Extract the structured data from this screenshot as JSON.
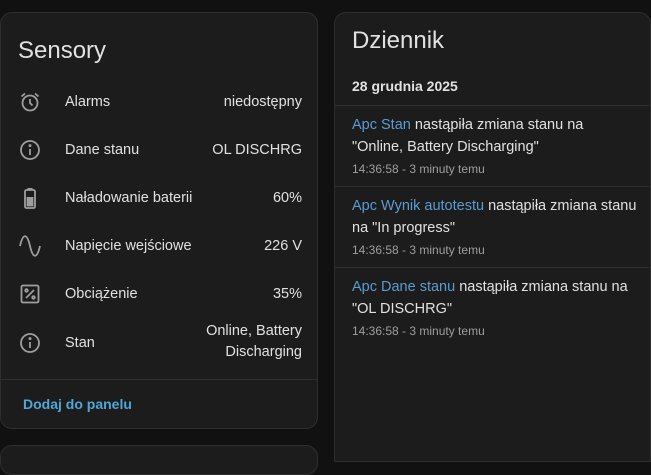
{
  "sensors": {
    "title": "Sensory",
    "rows": [
      {
        "icon": "alarm-clock-icon",
        "label": "Alarms",
        "value": "niedostępny"
      },
      {
        "icon": "info-icon",
        "label": "Dane stanu",
        "value": "OL DISCHRG"
      },
      {
        "icon": "battery-icon",
        "label": "Naładowanie baterii",
        "value": "60%"
      },
      {
        "icon": "sine-wave-icon",
        "label": "Napięcie wejściowe",
        "value": "226 V"
      },
      {
        "icon": "percent-box-icon",
        "label": "Obciążenie",
        "value": "35%"
      },
      {
        "icon": "info-icon",
        "label": "Stan",
        "value": "Online, Battery Discharging"
      }
    ],
    "action": "Dodaj do panelu"
  },
  "log": {
    "title": "Dziennik",
    "date": "28 grudnia 2025",
    "entries": [
      {
        "entity": "Apc Stan",
        "message": " nastąpiła zmiana stanu na \"Online, Battery Discharging\"",
        "time": "14:36:58 - 3 minuty temu"
      },
      {
        "entity": "Apc Wynik autotestu",
        "message": " nastąpiła zmiana stanu na \"In progress\"",
        "time": "14:36:58 - 3 minuty temu"
      },
      {
        "entity": "Apc Dane stanu",
        "message": " nastąpiła zmiana stanu na \"OL DISCHRG\"",
        "time": "14:36:58 - 3 minuty temu"
      }
    ]
  },
  "colors": {
    "background": "#111111",
    "card": "#1c1c1c",
    "text": "#e1e1e1",
    "accent": "#4fa6d9",
    "entity_link": "#5a9bd1",
    "icon": "#9e9e9e",
    "secondary_text": "#9e9e9e"
  }
}
